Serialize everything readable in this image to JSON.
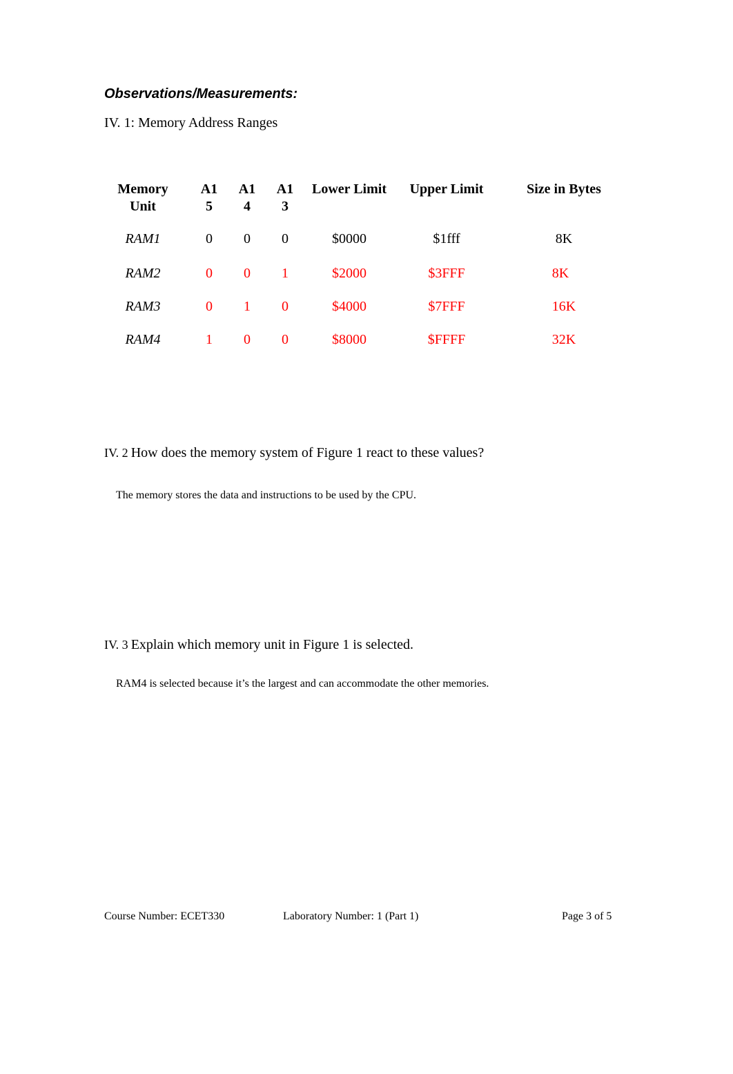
{
  "section_title": "Observations/Measurements:",
  "subheading": "IV. 1: Memory Address Ranges",
  "table": {
    "headers": {
      "memory_unit": [
        "Memory",
        "Unit"
      ],
      "a15": [
        "A1",
        "5"
      ],
      "a14": [
        "A1",
        "4"
      ],
      "a13": [
        "A1",
        "3"
      ],
      "lower_limit": "Lower Limit",
      "upper_limit": "Upper Limit",
      "size": "Size in Bytes"
    },
    "rows": [
      {
        "unit": "RAM1",
        "a15": "0",
        "a14": "0",
        "a13": "0",
        "lower": "$0000",
        "upper": "$1fff",
        "size": "8K",
        "highlight": false
      },
      {
        "unit": "RAM2",
        "a15": "0",
        "a14": "0",
        "a13": "1",
        "lower": "$2000",
        "upper": "$3FFF",
        "size": "8K",
        "highlight": true
      },
      {
        "unit": "RAM3",
        "a15": "0",
        "a14": "1",
        "a13": "0",
        "lower": "$4000",
        "upper": "$7FFF",
        "size": "16K",
        "highlight": true
      },
      {
        "unit": "RAM4",
        "a15": "1",
        "a14": "0",
        "a13": "0",
        "lower": "$8000",
        "upper": "$FFFF",
        "size": "32K",
        "highlight": true
      }
    ],
    "highlight_color": "#ff0000"
  },
  "questions": [
    {
      "label": "IV. 2",
      "text": "How does the memory system of Figure 1 react to these values?",
      "answer": "The memory stores the data and instructions to be used by the CPU."
    },
    {
      "label": "IV. 3",
      "text": "Explain which memory unit in Figure 1 is selected.",
      "answer": "RAM4 is selected because it’s the largest and can accommodate the other memories."
    }
  ],
  "footer": {
    "course": "Course Number: ECET330",
    "lab": "Laboratory Number: 1 (Part 1)",
    "page": "Page 3 of 5"
  }
}
